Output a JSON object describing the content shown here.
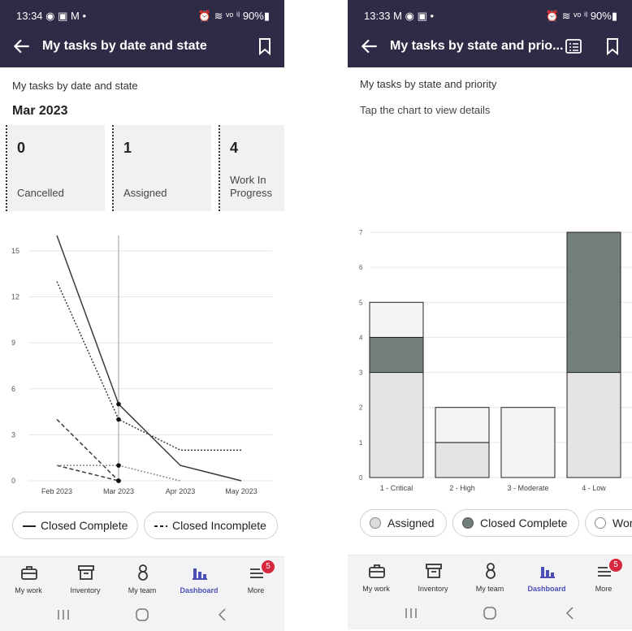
{
  "left": {
    "status": {
      "time": "13:34",
      "icons": "◉ ▣ M •",
      "right": "⏰ ≋ ᵛᵒ ⁱˡ 90%▮"
    },
    "header": {
      "title": "My tasks by date and state"
    },
    "subtitle": "My tasks by date and state",
    "month": "Mar 2023",
    "cards": [
      {
        "count": "0",
        "label": "Cancelled"
      },
      {
        "count": "1",
        "label": "Assigned"
      },
      {
        "count": "4",
        "label": "Work In Progress"
      }
    ],
    "legend": [
      {
        "label": "Closed Complete",
        "style": "solid"
      },
      {
        "label": "Closed Incomplete",
        "style": "dashed"
      }
    ]
  },
  "right": {
    "status": {
      "time": "13:33",
      "icons": "M ◉ ▣ •",
      "right": "⏰ ≋ ᵛᵒ ⁱˡ 90%▮"
    },
    "header": {
      "title": "My tasks by state and prio..."
    },
    "subtitle": "My tasks by state and priority",
    "hint": "Tap the chart to view details",
    "legend": [
      {
        "label": "Assigned",
        "color": "#dcdcdf"
      },
      {
        "label": "Closed Complete",
        "color": "#737f7d"
      },
      {
        "label": "Wor",
        "color": "#ffffff"
      }
    ]
  },
  "tabs": [
    {
      "label": "My work",
      "icon": "briefcase-icon"
    },
    {
      "label": "Inventory",
      "icon": "inventory-box-icon"
    },
    {
      "label": "My team",
      "icon": "person-icon"
    },
    {
      "label": "Dashboard",
      "icon": "bar-chart-icon",
      "active": true
    },
    {
      "label": "More",
      "icon": "menu-icon",
      "badge": "5"
    }
  ],
  "colors": {
    "header": "#2d2b45",
    "accent": "#4b4fb6",
    "badge": "#d7263d"
  },
  "chart_data": [
    {
      "type": "line",
      "x": [
        "Feb 2023",
        "Mar 2023",
        "Apr 2023",
        "May 2023"
      ],
      "ylim": [
        0,
        16
      ],
      "yticks": [
        0,
        3,
        6,
        9,
        12,
        15
      ],
      "xticks": [
        "Feb 2023",
        "Mar 2023",
        "Apr 2023",
        "May 2023"
      ],
      "series": [
        {
          "values": [
            16,
            5,
            1,
            0
          ],
          "style": "solid"
        },
        {
          "values": [
            13,
            4,
            2,
            2
          ],
          "style": "dotted"
        },
        {
          "values": [
            4,
            0,
            null,
            null
          ],
          "style": "dashed"
        },
        {
          "values": [
            1,
            0,
            null,
            null
          ],
          "style": "dashed"
        },
        {
          "values": [
            1,
            1,
            0,
            null
          ],
          "style": "dotted-light"
        }
      ],
      "marker_x": "Mar 2023"
    },
    {
      "type": "bar",
      "categories": [
        "1 - Critical",
        "2 - High",
        "3 - Moderate",
        "4 - Low"
      ],
      "ylim": [
        0,
        7
      ],
      "yticks": [
        0,
        1,
        2,
        3,
        4,
        5,
        6,
        7
      ],
      "series": [
        {
          "name": "Assigned",
          "values": [
            3,
            1,
            0,
            3
          ]
        },
        {
          "name": "Closed Complete",
          "values": [
            1,
            0,
            0,
            4
          ]
        },
        {
          "name": "Wor",
          "values": [
            1,
            1,
            2,
            0
          ]
        }
      ]
    }
  ]
}
